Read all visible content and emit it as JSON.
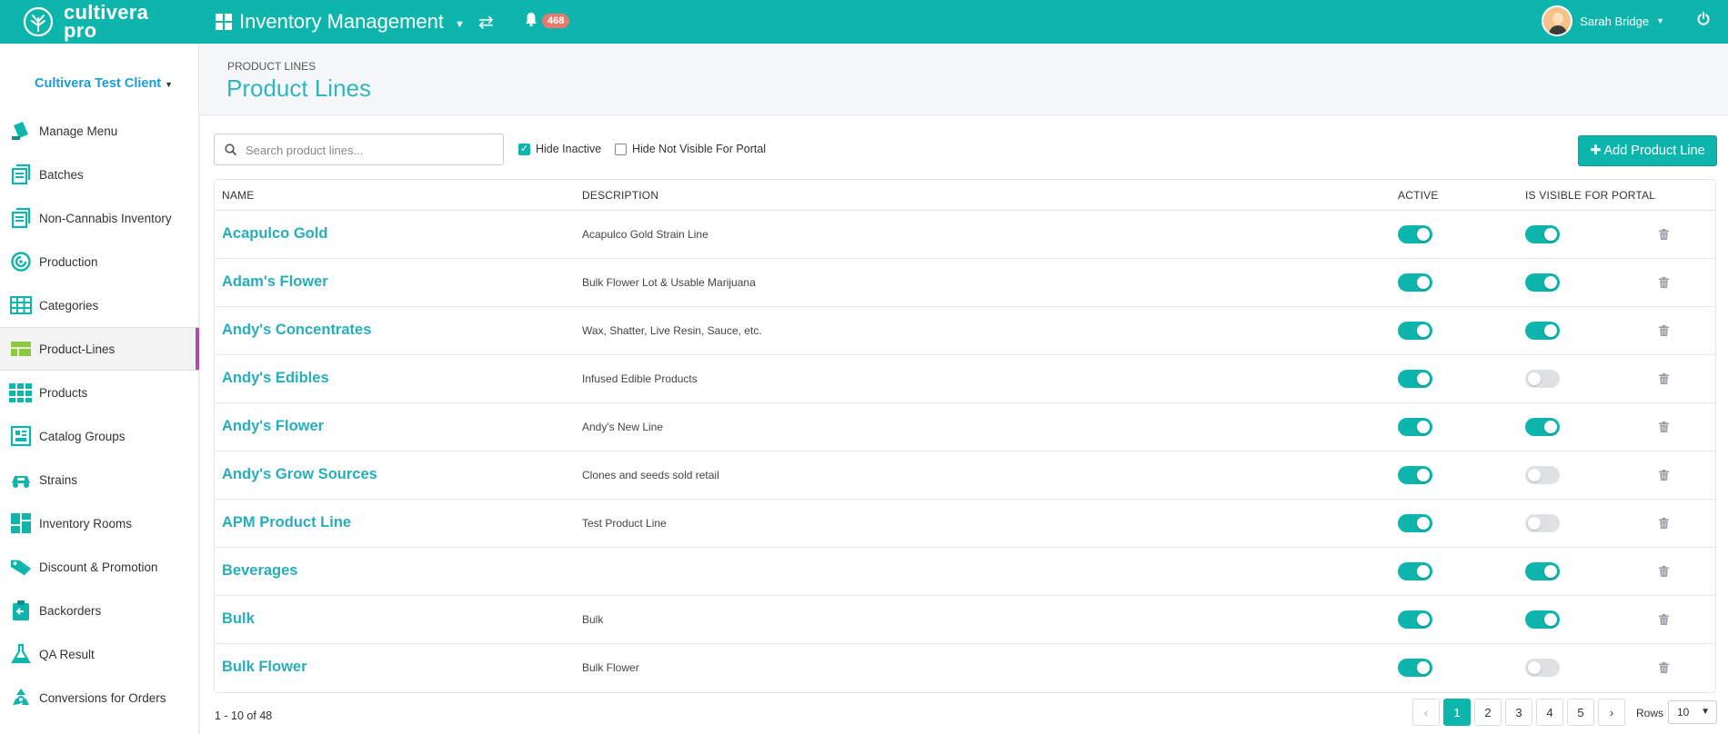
{
  "app": {
    "logo_line1": "cultivera",
    "logo_line2": "pro",
    "module": "Inventory Management",
    "notification_count": "468",
    "user_name": "Sarah Bridge"
  },
  "sidebar": {
    "client": "Cultivera Test Client",
    "items": [
      {
        "label": "Manage Menu",
        "icon": "manage-menu-icon"
      },
      {
        "label": "Batches",
        "icon": "batches-icon"
      },
      {
        "label": "Non-Cannabis Inventory",
        "icon": "non-cannabis-inventory-icon"
      },
      {
        "label": "Production",
        "icon": "production-icon"
      },
      {
        "label": "Categories",
        "icon": "categories-icon"
      },
      {
        "label": "Product-Lines",
        "icon": "product-lines-icon",
        "active": true
      },
      {
        "label": "Products",
        "icon": "products-icon"
      },
      {
        "label": "Catalog Groups",
        "icon": "catalog-groups-icon"
      },
      {
        "label": "Strains",
        "icon": "strains-icon"
      },
      {
        "label": "Inventory Rooms",
        "icon": "inventory-rooms-icon"
      },
      {
        "label": "Discount & Promotion",
        "icon": "discount-promotion-icon"
      },
      {
        "label": "Backorders",
        "icon": "backorders-icon"
      },
      {
        "label": "QA Result",
        "icon": "qa-result-icon"
      },
      {
        "label": "Conversions for Orders",
        "icon": "conversions-icon"
      }
    ]
  },
  "page": {
    "breadcrumb": "PRODUCT LINES",
    "title": "Product Lines"
  },
  "toolbar": {
    "search_placeholder": "Search product lines...",
    "search_value": "",
    "hide_inactive_label": "Hide Inactive",
    "hide_inactive_checked": true,
    "hide_not_visible_label": "Hide Not Visible For Portal",
    "hide_not_visible_checked": false,
    "add_button_label": "Add Product Line"
  },
  "table": {
    "columns": {
      "name": "NAME",
      "description": "DESCRIPTION",
      "active": "ACTIVE",
      "visible": "IS VISIBLE FOR PORTAL"
    },
    "rows": [
      {
        "name": "Acapulco Gold",
        "description": "Acapulco Gold Strain Line",
        "active": true,
        "visible": true
      },
      {
        "name": "Adam's Flower",
        "description": "Bulk Flower Lot & Usable Marijuana",
        "active": true,
        "visible": true
      },
      {
        "name": "Andy's Concentrates",
        "description": "Wax, Shatter, Live Resin, Sauce, etc.",
        "active": true,
        "visible": true
      },
      {
        "name": "Andy's Edibles",
        "description": "Infused Edible Products",
        "active": true,
        "visible": false
      },
      {
        "name": "Andy's Flower",
        "description": "Andy's New Line",
        "active": true,
        "visible": true
      },
      {
        "name": "Andy's Grow Sources",
        "description": "Clones and seeds sold retail",
        "active": true,
        "visible": false
      },
      {
        "name": "APM Product Line",
        "description": "Test Product Line",
        "active": true,
        "visible": false
      },
      {
        "name": "Beverages",
        "description": "",
        "active": true,
        "visible": true
      },
      {
        "name": "Bulk",
        "description": "Bulk",
        "active": true,
        "visible": true
      },
      {
        "name": "Bulk Flower",
        "description": "Bulk Flower",
        "active": true,
        "visible": false
      }
    ]
  },
  "pagination": {
    "range_text": "1 - 10 of 48",
    "prev": "‹",
    "next": "›",
    "pages": [
      "1",
      "2",
      "3",
      "4",
      "5"
    ],
    "current_page": "1",
    "rows_label": "Rows",
    "rows_value": "10"
  },
  "colors": {
    "brand": "#0db5ad",
    "link": "#26aebd",
    "active_marker": "#b04aa6",
    "badge": "#e67a6c"
  }
}
